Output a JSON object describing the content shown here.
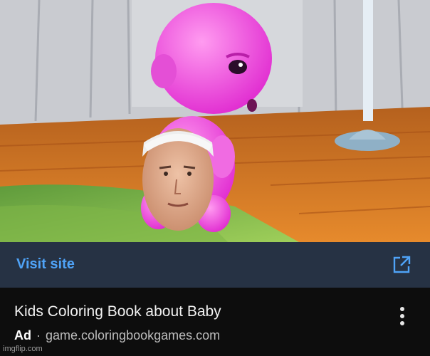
{
  "ad": {
    "cta_label": "Visit site",
    "title": "Kids Coloring Book about Baby",
    "badge": "Ad",
    "separator": "·",
    "domain": "game.coloringbookgames.com"
  },
  "watermark": "imgflip.com",
  "icons": {
    "cta": "external-link-icon",
    "menu": "more-vertical-icon"
  },
  "colors": {
    "cta_bar": "#263244",
    "cta_text": "#4fa3f7",
    "background": "#0d0d0d"
  }
}
